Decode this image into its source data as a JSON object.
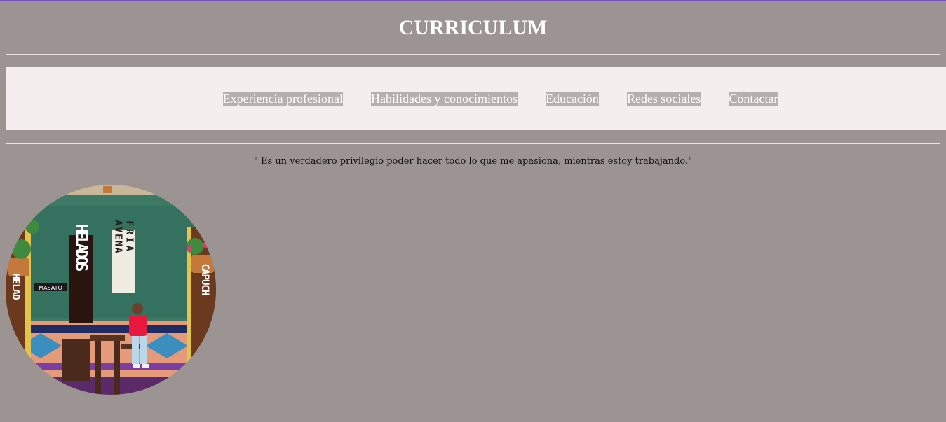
{
  "header": {
    "title": "CURRICULUM"
  },
  "nav": {
    "items": [
      {
        "label": "Experiencia profesional"
      },
      {
        "label": "Habilidades y conocimientos"
      },
      {
        "label": "Educación"
      },
      {
        "label": "Redes sociales"
      },
      {
        "label": "Contactar"
      }
    ]
  },
  "quote": {
    "text": "\" Es un verdadero privilegio poder hacer todo lo que me apasiona, mientras estoy trabajando.\""
  },
  "profile_photo": {
    "signs": {
      "helados": "HELADOS",
      "avena": "AVENA",
      "fria": "FRIA",
      "masato": "MASATO",
      "helado_left": "HELAD",
      "capuch": "CAPUCH"
    }
  },
  "colors": {
    "page_background": "#9c9493",
    "nav_background": "#f4eeee",
    "nav_link_background": "#b7afae",
    "top_accent": "#7a4fbf"
  }
}
